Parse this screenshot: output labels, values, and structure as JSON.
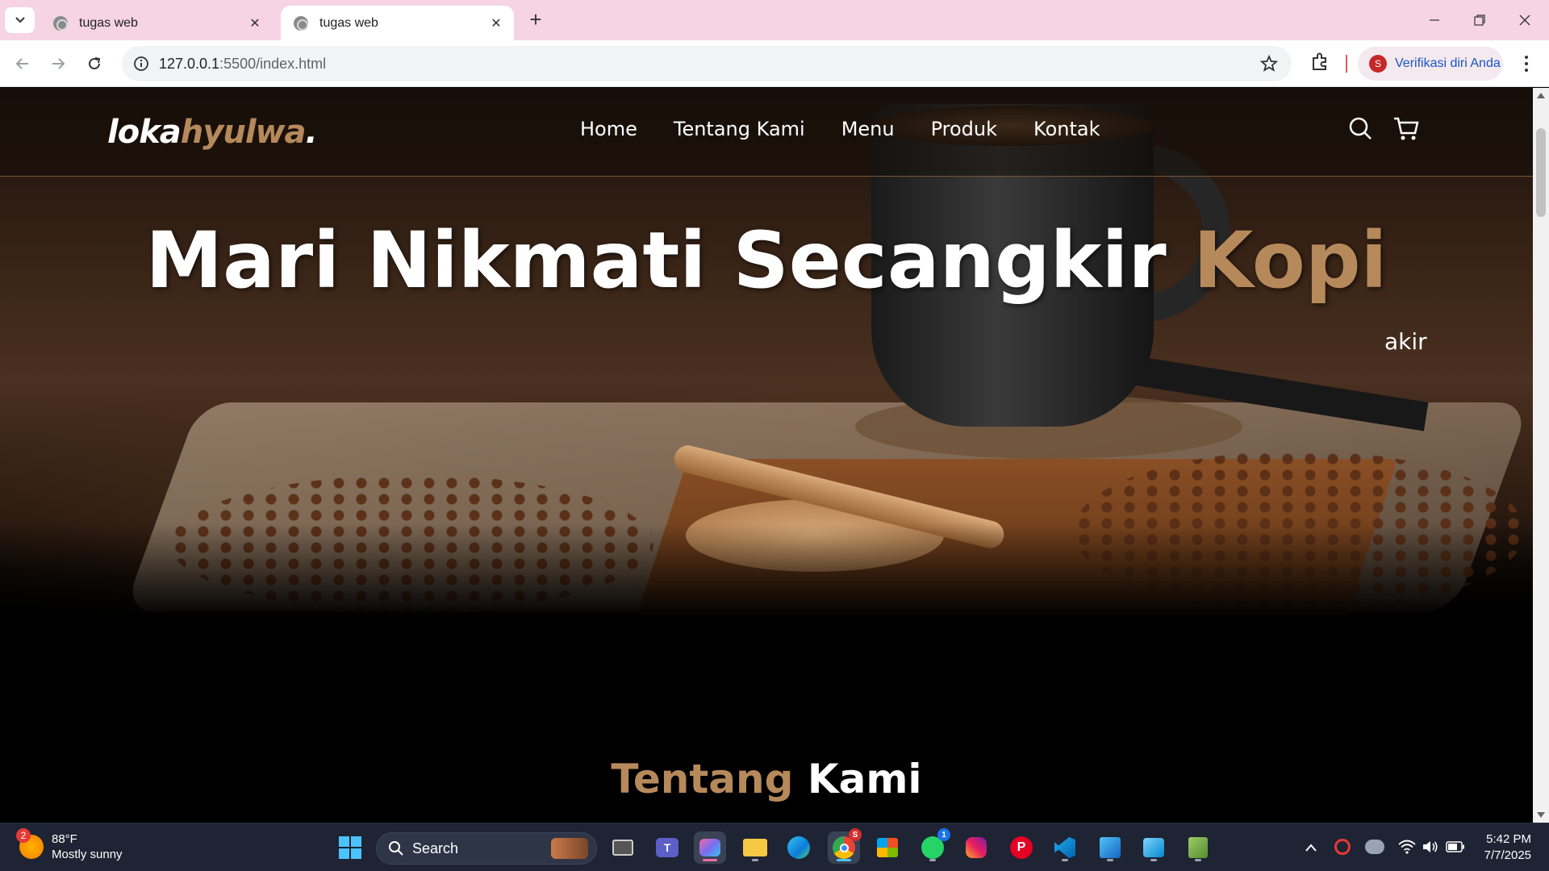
{
  "browser": {
    "tabs": [
      {
        "title": "tugas web",
        "active": false
      },
      {
        "title": "tugas web",
        "active": true
      }
    ],
    "url_host": "127.0.0.1",
    "url_rest": ":5500/index.html",
    "profile_label": "Verifikasi diri Anda",
    "profile_initial": "S"
  },
  "site": {
    "logo_main": "loka",
    "logo_accent": "hyulwa",
    "logo_dot": ".",
    "nav": [
      "Home",
      "Tentang Kami",
      "Menu",
      "Produk",
      "Kontak"
    ],
    "hero_title_main": "Mari Nikmati Secangkir",
    "hero_title_accent": "Kopi",
    "hero_sub": "akir",
    "about_title_accent": "Tentang",
    "about_title_main": "Kami",
    "accent_color": "#b6895b"
  },
  "taskbar": {
    "weather_temp": "88°F",
    "weather_desc": "Mostly sunny",
    "weather_badge": "2",
    "search_label": "Search",
    "whatsapp_badge": "1",
    "chrome_badge": "S",
    "time": "5:42 PM",
    "date": "7/7/2025"
  }
}
